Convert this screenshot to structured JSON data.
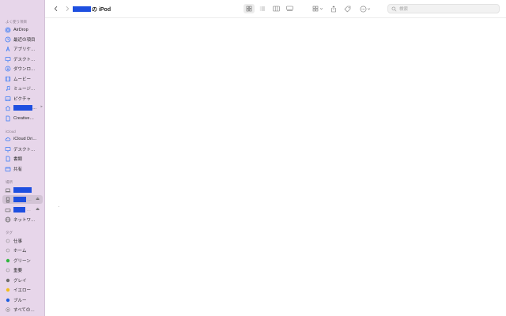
{
  "toolbar": {
    "title_suffix": "の iPod",
    "search_placeholder": "検索"
  },
  "sidebar": {
    "favorites_header": "よく使う項目",
    "favorites": [
      {
        "label": "AirDrop",
        "icon": "airdrop-icon"
      },
      {
        "label": "最近の項目",
        "icon": "clock-icon"
      },
      {
        "label": "アプリケ…",
        "icon": "applications-icon"
      },
      {
        "label": "デスクト…",
        "icon": "desktop-icon"
      },
      {
        "label": "ダウンロ…",
        "icon": "download-icon"
      },
      {
        "label": "ムービー",
        "icon": "film-icon"
      },
      {
        "label": "ミュージ…",
        "icon": "music-icon"
      },
      {
        "label": "ピクチャ",
        "icon": "photo-icon"
      },
      {
        "label": "",
        "icon": "home-icon",
        "redacted": true
      },
      {
        "label": "Creative…",
        "icon": "document-icon"
      }
    ],
    "icloud_header": "iCloud",
    "icloud": [
      {
        "label": "iCloud Dri…",
        "icon": "cloud-icon"
      },
      {
        "label": "デスクト…",
        "icon": "desktop-icon"
      },
      {
        "label": "書類",
        "icon": "document-icon"
      },
      {
        "label": "共有",
        "icon": "shared-folder-icon"
      }
    ],
    "locations_header": "場所",
    "locations": [
      {
        "label": "",
        "icon": "laptop-icon",
        "redacted": true
      },
      {
        "label": "",
        "icon": "ipod-icon",
        "redacted": true,
        "selected": true,
        "eject": true
      },
      {
        "label": "",
        "icon": "drive-icon",
        "redacted": true,
        "eject": true
      },
      {
        "label": "ネットワ…",
        "icon": "network-icon"
      }
    ],
    "tags_header": "タグ",
    "tags": [
      {
        "label": "仕事",
        "color": "#ffffff"
      },
      {
        "label": "ホーム",
        "color": "#ffffff"
      },
      {
        "label": "グリーン",
        "color": "#2fb63d"
      },
      {
        "label": "重要",
        "color": "#ffffff"
      },
      {
        "label": "グレイ",
        "color": "#6e6e6e"
      },
      {
        "label": "イエロー",
        "color": "#f2bc1b"
      },
      {
        "label": "ブルー",
        "color": "#1f5fe0"
      },
      {
        "label": "すべての…",
        "color": "all-tags"
      }
    ]
  },
  "colors": {
    "sidebar_bg": "#e7d6ea",
    "redaction": "#1e4fe0",
    "selected_row": "#d2c3d5"
  }
}
